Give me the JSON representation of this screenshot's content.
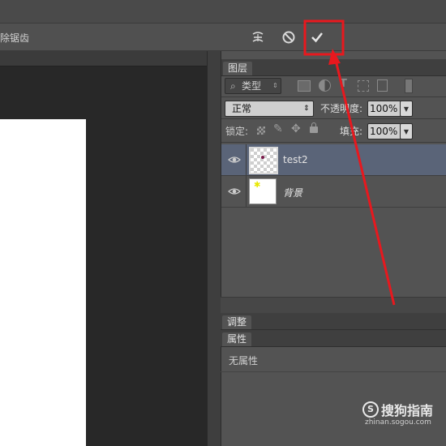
{
  "options_bar": {
    "antialias_label": "除锯齿",
    "icons": [
      "warp-icon",
      "cancel-transform-icon",
      "commit-transform-icon"
    ]
  },
  "layers_panel": {
    "tab_label": "图层",
    "filter": {
      "kind_label": "类型",
      "icons": [
        "image-filter-icon",
        "adjustment-filter-icon",
        "type-filter-icon",
        "shape-filter-icon",
        "smart-object-filter-icon",
        "filter-toggle-icon"
      ]
    },
    "blend_mode": "正常",
    "opacity_label": "不透明度:",
    "opacity_value": "100%",
    "lock_label": "锁定:",
    "fill_label": "填充:",
    "fill_value": "100%",
    "layers": [
      {
        "name": "test2",
        "selected": true,
        "visible": true
      },
      {
        "name": "背景",
        "selected": false,
        "visible": true,
        "italic": true
      }
    ]
  },
  "adjustments_panel": {
    "tab_label": "调整"
  },
  "properties_panel": {
    "tab_label": "属性",
    "body_text": "无属性"
  },
  "watermark": {
    "logo_text": "搜狗指南",
    "url": "zhinan.sogou.com"
  },
  "colors": {
    "annotation_red": "#e8181e",
    "selected_row": "#5a6478",
    "panel_bg": "#535353",
    "canvas_bg": "#282828"
  }
}
